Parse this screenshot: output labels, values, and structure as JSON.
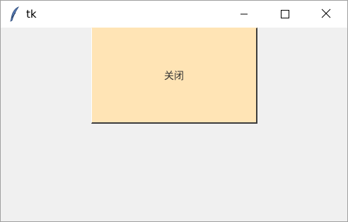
{
  "window": {
    "title": "tk",
    "icon": "feather-icon",
    "controls": {
      "minimize_icon": "minimize-icon",
      "maximize_icon": "maximize-icon",
      "close_icon": "close-icon"
    }
  },
  "main": {
    "close_button_label": "关闭",
    "close_button_bg": "#ffe4b5"
  }
}
